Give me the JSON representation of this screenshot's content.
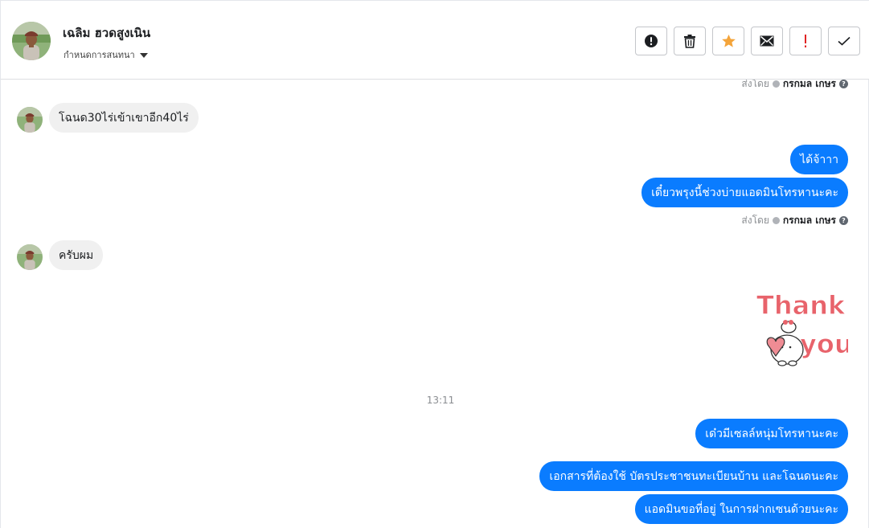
{
  "header": {
    "contact_name": "เฉลิม ฮวดสูงเนิน",
    "assign_label": "กำหนดการสนทนา",
    "avatar_icon": "user-avatar-photo",
    "actions": [
      {
        "name": "mark-spam-button",
        "icon": "alert-circle-icon"
      },
      {
        "name": "delete-button",
        "icon": "trash-icon"
      },
      {
        "name": "star-button",
        "icon": "star-icon",
        "color": "#f4a43a"
      },
      {
        "name": "mark-unread-button",
        "icon": "envelope-icon"
      },
      {
        "name": "follow-up-button",
        "icon": "exclamation-icon",
        "color": "#e02424"
      },
      {
        "name": "mark-done-button",
        "icon": "checkmark-icon"
      }
    ]
  },
  "colors": {
    "outgoing_bubble": "#0a7cff",
    "incoming_bubble": "#f0f0f0",
    "sticker_text": "#e8636b"
  },
  "messages": {
    "sent_by_label": "ส่งโดย",
    "sent_by_name": "กรกมล เกษร",
    "incoming_1": "โฉนด30ไร่เข้าเขาอีก40ไร่",
    "outgoing_1": "ได้จ้าาา",
    "outgoing_2": "เดี๋ยวพรุงนี้ช่วงบ่ายแอดมินโทรหานะคะ",
    "incoming_2": "ครับผม",
    "sticker": {
      "line1": "Thank",
      "line2": "you"
    },
    "timestamp": "13:11",
    "outgoing_3": "เด๋วมีเซลล์หนุ่มโทรหานะคะ",
    "outgoing_4": "เอกสารที่ต้องใช้  บัตรประชาชนทะเบียนบ้าน และโฉนดนะคะ",
    "outgoing_5": "แอดมินขอที่อยู่ ในการฝากเซนด้วยนะคะ"
  }
}
